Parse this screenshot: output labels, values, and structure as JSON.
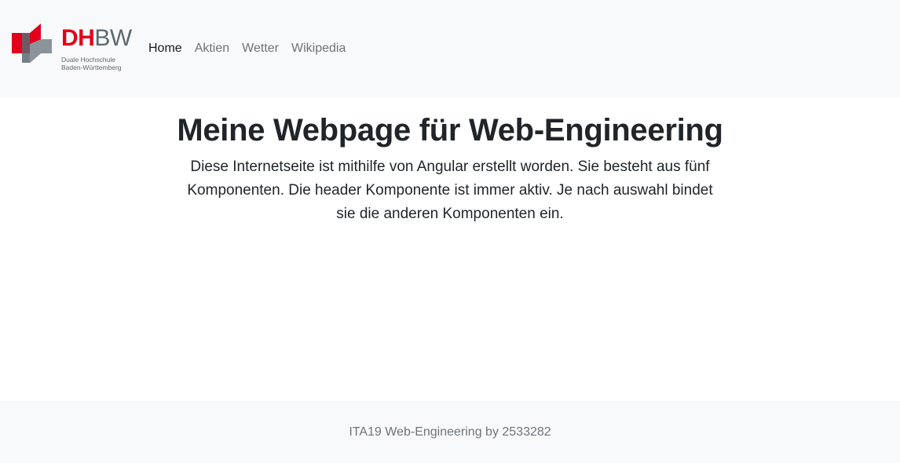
{
  "header": {
    "logo": {
      "wordmark_primary": "DH",
      "wordmark_secondary": "BW",
      "subtitle_line1": "Duale Hochschule",
      "subtitle_line2": "Baden-Württemberg"
    },
    "nav": [
      {
        "label": "Home",
        "active": true
      },
      {
        "label": "Aktien",
        "active": false
      },
      {
        "label": "Wetter",
        "active": false
      },
      {
        "label": "Wikipedia",
        "active": false
      }
    ]
  },
  "main": {
    "title": "Meine Webpage für Web-Engineering",
    "description": "Diese Internetseite ist mithilfe von Angular erstellt worden. Sie besteht aus fünf Komponenten. Die header Komponente ist immer aktiv. Je nach auswahl bindet sie die anderen Komponenten ein."
  },
  "footer": {
    "text": "ITA19 Web-Engineering by 2533282"
  },
  "colors": {
    "navbar_bg": "#f8f9fa",
    "brand_red": "#e2001a",
    "brand_gray": "#5c6971",
    "text_dark": "#212529",
    "text_muted": "#6c757d"
  }
}
